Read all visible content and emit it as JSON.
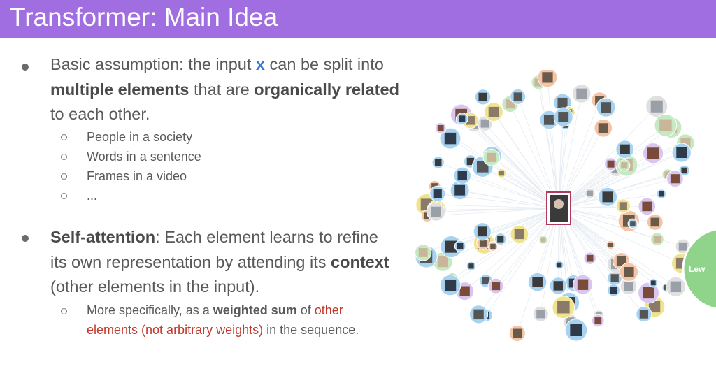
{
  "slide": {
    "title": "Transformer: Main Idea",
    "bullet1": {
      "t1": "Basic assumption: the input ",
      "x": "x",
      "t2": " can be split into ",
      "b1": "multiple elements",
      "t3": " that are ",
      "b2": "organically related",
      "t4": " to each other."
    },
    "subs1": [
      "People in a society",
      "Words in a sentence",
      "Frames in a video",
      "..."
    ],
    "bullet2": {
      "b1": "Self-attention",
      "t1": ": Each element learns to refine its own representation by attending its ",
      "b2": "context",
      "t2": " (other elements in the input)."
    },
    "sub2": {
      "t1": "More specifically, as a ",
      "b1": "weighted sum",
      "t2": " of ",
      "r1": "other",
      "r2": "elements (not arbitrary weights)",
      "t3": " in the sequence."
    },
    "graph_label": "Lew"
  }
}
